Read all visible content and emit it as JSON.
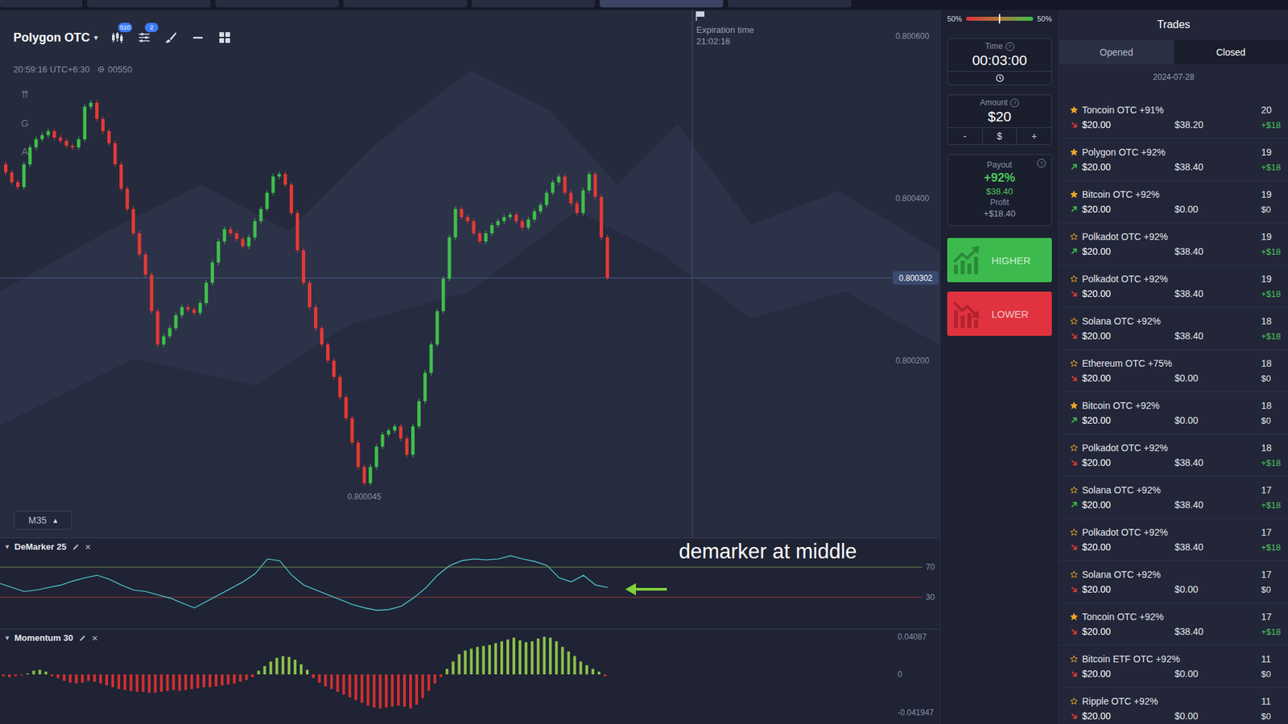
{
  "top_tabs": [
    {
      "selected": false
    },
    {
      "selected": false
    },
    {
      "selected": false
    },
    {
      "selected": false
    },
    {
      "selected": false
    },
    {
      "selected": true
    },
    {
      "selected": false
    }
  ],
  "chart": {
    "symbol": "Polygon OTC",
    "symbol_caret": "▾",
    "toolbar_badges": [
      "510",
      "2"
    ],
    "clock": "20:59:16 UTC+6:30",
    "server": "00550",
    "side_tools": [
      "⇈",
      "G",
      "A"
    ],
    "timeframe": "M35",
    "timeframe_caret": "▴",
    "expiration": {
      "label": "Expiration time",
      "time": "21:02:16"
    },
    "price_ticks": [
      "0.800600",
      "0.800400",
      "0.800200"
    ],
    "current_price": "0.800302",
    "low_label": "0.800045",
    "closes": [
      0.800442,
      0.800432,
      0.80042,
      0.800414,
      0.800442,
      0.800463,
      0.800473,
      0.800478,
      0.800483,
      0.800475,
      0.800471,
      0.800465,
      0.800463,
      0.800473,
      0.800513,
      0.800518,
      0.800498,
      0.800483,
      0.800468,
      0.800442,
      0.800412,
      0.800387,
      0.800357,
      0.800331,
      0.800306,
      0.800261,
      0.80022,
      0.80023,
      0.80024,
      0.800256,
      0.800266,
      0.800263,
      0.800259,
      0.800271,
      0.800296,
      0.800321,
      0.800347,
      0.800362,
      0.800357,
      0.80035,
      0.800341,
      0.800352,
      0.800372,
      0.800387,
      0.800407,
      0.800427,
      0.80043,
      0.800417,
      0.800382,
      0.800336,
      0.800296,
      0.800266,
      0.80024,
      0.80022,
      0.8002,
      0.80018,
      0.800155,
      0.800129,
      0.800099,
      0.800069,
      0.800049,
      0.800069,
      0.800094,
      0.800109,
      0.800114,
      0.800119,
      0.800104,
      0.800084,
      0.800119,
      0.80015,
      0.800185,
      0.80022,
      0.800261,
      0.800301,
      0.800352,
      0.800387,
      0.800377,
      0.800372,
      0.800357,
      0.800347,
      0.800357,
      0.800367,
      0.800372,
      0.800377,
      0.80038,
      0.800372,
      0.800364,
      0.800374,
      0.800384,
      0.800392,
      0.800407,
      0.80042,
      0.800427,
      0.800407,
      0.800394,
      0.800382,
      0.80041,
      0.80043,
      0.800402,
      0.800352,
      0.800302
    ]
  },
  "demarker": {
    "caret": "▾",
    "title": "DeMarker 25",
    "close": "×",
    "levels": [
      "70",
      "30"
    ],
    "values": [
      48.4,
      43.0,
      37.6,
      39.7,
      43.0,
      46.2,
      51.6,
      55.9,
      59.2,
      53.8,
      46.2,
      39.7,
      37.6,
      33.2,
      28.9,
      22.4,
      16.0,
      24.6,
      33.2,
      41.9,
      50.5,
      61.4,
      80.8,
      78.6,
      59.2,
      46.2,
      39.7,
      33.2,
      26.8,
      20.3,
      16.0,
      12.7,
      13.8,
      18.1,
      28.9,
      41.9,
      59.2,
      72.2,
      78.6,
      80.8,
      79.7,
      80.8,
      85.1,
      80.8,
      77.6,
      72.2,
      55.9,
      50.5,
      59.2,
      46.2,
      43.0
    ]
  },
  "momentum": {
    "caret": "▾",
    "title": "Momentum 30",
    "close": "×",
    "ticks": [
      "0.04087",
      "0",
      "-0.041947"
    ],
    "values": [
      -0.002,
      -0.003,
      -0.002,
      -0.001,
      0.001,
      0.004,
      0.005,
      0.003,
      -0.002,
      -0.004,
      -0.007,
      -0.009,
      -0.01,
      -0.009,
      -0.007,
      -0.008,
      -0.01,
      -0.012,
      -0.014,
      -0.016,
      -0.017,
      -0.018,
      -0.019,
      -0.019,
      -0.02,
      -0.02,
      -0.019,
      -0.018,
      -0.017,
      -0.018,
      -0.017,
      -0.016,
      -0.015,
      -0.014,
      -0.014,
      -0.013,
      -0.012,
      -0.011,
      -0.01,
      -0.008,
      -0.006,
      -0.003,
      0.004,
      0.009,
      0.014,
      0.018,
      0.02,
      0.019,
      0.016,
      0.011,
      0.005,
      -0.004,
      -0.009,
      -0.013,
      -0.016,
      -0.019,
      -0.022,
      -0.025,
      -0.028,
      -0.031,
      -0.034,
      -0.036,
      -0.037,
      -0.036,
      -0.035,
      -0.034,
      -0.035,
      -0.037,
      -0.033,
      -0.026,
      -0.018,
      -0.01,
      -0.003,
      0.006,
      0.014,
      0.022,
      0.026,
      0.028,
      0.03,
      0.031,
      0.032,
      0.034,
      0.036,
      0.038,
      0.04,
      0.037,
      0.035,
      0.036,
      0.039,
      0.041,
      0.04,
      0.036,
      0.03,
      0.025,
      0.02,
      0.014,
      0.01,
      0.006,
      0.003,
      -0.002
    ]
  },
  "annotation": {
    "text": "demarker at middle"
  },
  "help": "?",
  "sentiment": {
    "left": "50%",
    "right": "50%",
    "level": 0.5
  },
  "time": {
    "label": "Time",
    "value": "00:03:00"
  },
  "amount": {
    "label": "Amount",
    "value": "$20",
    "minus": "-",
    "currency": "$",
    "plus": "+"
  },
  "payout": {
    "label": "Payout",
    "percent": "+92%",
    "value": "$38.40",
    "profit_label": "Profit",
    "profit": "+$18.40"
  },
  "buttons": [
    {
      "label": "HIGHER",
      "kind": "higher"
    },
    {
      "label": "LOWER",
      "kind": "lower"
    }
  ],
  "trades": {
    "title": "Trades",
    "tabs": [
      {
        "label": "Opened",
        "selected": false
      },
      {
        "label": "Closed",
        "selected": true
      }
    ],
    "date": "2024-07-28",
    "items": [
      {
        "name": "Toncoin OTC",
        "pct": "+91%",
        "favorite": true,
        "direction": "down",
        "amount": "$20.00",
        "result": "$38.20",
        "time": "20",
        "profit": "+$18",
        "won": true
      },
      {
        "name": "Polygon OTC",
        "pct": "+92%",
        "favorite": true,
        "direction": "up",
        "amount": "$20.00",
        "result": "$38.40",
        "time": "19",
        "profit": "+$18",
        "won": true
      },
      {
        "name": "Bitcoin OTC",
        "pct": "+92%",
        "favorite": true,
        "direction": "up",
        "amount": "$20.00",
        "result": "$0.00",
        "time": "19",
        "profit": "$0",
        "won": false
      },
      {
        "name": "Polkadot OTC",
        "pct": "+92%",
        "favorite": false,
        "direction": "up",
        "amount": "$20.00",
        "result": "$38.40",
        "time": "19",
        "profit": "+$18",
        "won": true
      },
      {
        "name": "Polkadot OTC",
        "pct": "+92%",
        "favorite": false,
        "direction": "down",
        "amount": "$20.00",
        "result": "$38.40",
        "time": "19",
        "profit": "+$18",
        "won": true
      },
      {
        "name": "Solana OTC",
        "pct": "+92%",
        "favorite": false,
        "direction": "down",
        "amount": "$20.00",
        "result": "$38.40",
        "time": "18",
        "profit": "+$18",
        "won": true
      },
      {
        "name": "Ethereum OTC",
        "pct": "+75%",
        "favorite": false,
        "direction": "down",
        "amount": "$20.00",
        "result": "$0.00",
        "time": "18",
        "profit": "$0",
        "won": false
      },
      {
        "name": "Bitcoin OTC",
        "pct": "+92%",
        "favorite": true,
        "direction": "up",
        "amount": "$20.00",
        "result": "$0.00",
        "time": "18",
        "profit": "$0",
        "won": false
      },
      {
        "name": "Polkadot OTC",
        "pct": "+92%",
        "favorite": false,
        "direction": "down",
        "amount": "$20.00",
        "result": "$38.40",
        "time": "18",
        "profit": "+$18",
        "won": true
      },
      {
        "name": "Solana OTC",
        "pct": "+92%",
        "favorite": false,
        "direction": "up",
        "amount": "$20.00",
        "result": "$38.40",
        "time": "17",
        "profit": "+$18",
        "won": true
      },
      {
        "name": "Polkadot OTC",
        "pct": "+92%",
        "favorite": false,
        "direction": "down",
        "amount": "$20.00",
        "result": "$38.40",
        "time": "17",
        "profit": "+$18",
        "won": true
      },
      {
        "name": "Solana OTC",
        "pct": "+92%",
        "favorite": false,
        "direction": "down",
        "amount": "$20.00",
        "result": "$0.00",
        "time": "17",
        "profit": "$0",
        "won": false
      },
      {
        "name": "Toncoin OTC",
        "pct": "+92%",
        "favorite": true,
        "direction": "down",
        "amount": "$20.00",
        "result": "$38.40",
        "time": "17",
        "profit": "+$18",
        "won": true
      },
      {
        "name": "Bitcoin ETF OTC",
        "pct": "+92%",
        "favorite": false,
        "direction": "down",
        "amount": "$20.00",
        "result": "$0.00",
        "time": "11",
        "profit": "$0",
        "won": false
      },
      {
        "name": "Ripple OTC",
        "pct": "+92%",
        "favorite": false,
        "direction": "down",
        "amount": "$20.00",
        "result": "$0.00",
        "time": "11",
        "profit": "$0",
        "won": false
      }
    ]
  }
}
